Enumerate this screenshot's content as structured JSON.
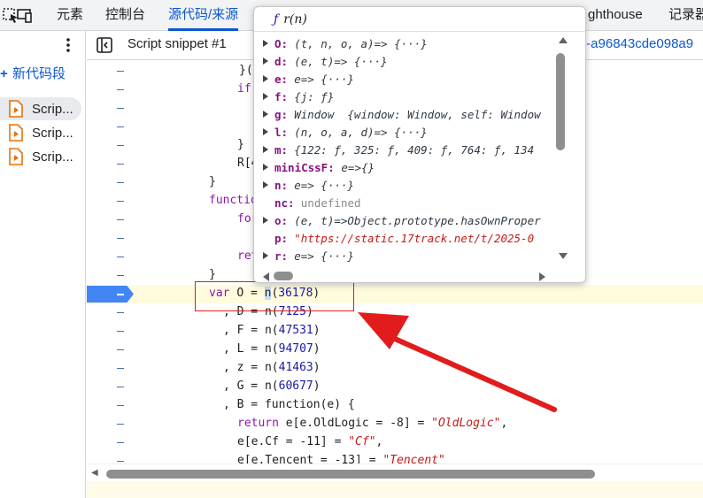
{
  "topbar": {
    "tabs": [
      "元素",
      "控制台",
      "源代码/来源",
      "ghthouse",
      "记录器"
    ]
  },
  "sidebar": {
    "new_snippet_label": "新代码段",
    "snippets": [
      "Scrip...",
      "Scrip...",
      "Scrip..."
    ]
  },
  "editor": {
    "title": "Script snippet #1",
    "right_tab": "t-a96843cde098a9"
  },
  "code": {
    "lines": [
      {
        "text": "}(e",
        "indent": 270
      },
      {
        "text": "if",
        "indent": 268
      },
      {
        "text": "",
        "indent": 268
      },
      {
        "text": "",
        "indent": 268
      },
      {
        "text": "}",
        "indent": 268
      },
      {
        "text": "R[4",
        "indent": 268
      },
      {
        "text": "}",
        "indent": 236
      },
      {
        "text": "functio",
        "indent": 236
      },
      {
        "text": "for",
        "indent": 268
      },
      {
        "text": "",
        "indent": 268
      },
      {
        "text": "ret",
        "indent": 268
      },
      {
        "text": "}",
        "indent": 236
      }
    ],
    "highlighted": {
      "kw": "var",
      "name": "O",
      "op": "=",
      "fn": "n",
      "arg": "36178"
    },
    "after": [
      {
        "name": "D",
        "arg": "7125"
      },
      {
        "name": "F",
        "arg": "47531"
      },
      {
        "name": "L",
        "arg": "94707"
      },
      {
        "name": "z",
        "arg": "41463"
      },
      {
        "name": "G",
        "arg": "60677"
      }
    ],
    "func_line": ", B = function(e) {",
    "return_line": {
      "kw": "return",
      "left": " e[e.OldLogic = -8] = ",
      "str": "\"OldLogic\"",
      "tail": ","
    },
    "cf_line": {
      "left": "e[e.Cf = -11] = ",
      "str": "\"Cf\"",
      "tail": ","
    },
    "tencent_line": {
      "left": "e[e.Tencent = -13] = ",
      "str": "\"Tencent\""
    }
  },
  "popover": {
    "title_f": "ƒ",
    "title": "r(n)",
    "props": [
      {
        "key": "O:",
        "val": "(t, n, o, a)=> {···}",
        "tri": true
      },
      {
        "key": "d:",
        "val": "(e, t)=> {···}",
        "tri": true
      },
      {
        "key": "e:",
        "val": "e=> {···}",
        "tri": true
      },
      {
        "key": "f:",
        "val": "{j: ƒ}",
        "tri": true
      },
      {
        "key": "g:",
        "val": "Window  {window: Window, self: Window",
        "tri": true
      },
      {
        "key": "l:",
        "val": "(n, o, a, d)=> {···}",
        "tri": true
      },
      {
        "key": "m:",
        "val": "{122: ƒ, 325: ƒ, 409: ƒ, 764: ƒ, 134",
        "tri": true
      },
      {
        "key": "miniCssF:",
        "val": "e=>{}",
        "tri": true
      },
      {
        "key": "n:",
        "val": "e=> {···}",
        "tri": true
      },
      {
        "key": "nc:",
        "val": "undefined",
        "tri": false,
        "style": "dim"
      },
      {
        "key": "o:",
        "val": "(e, t)=>Object.prototype.hasOwnProper",
        "tri": true
      },
      {
        "key": "p:",
        "val": "\"https://static.17track.net/t/2025-0",
        "tri": false,
        "style": "str"
      },
      {
        "key": "r:",
        "val": "e=> {···}",
        "tri": true
      }
    ]
  }
}
